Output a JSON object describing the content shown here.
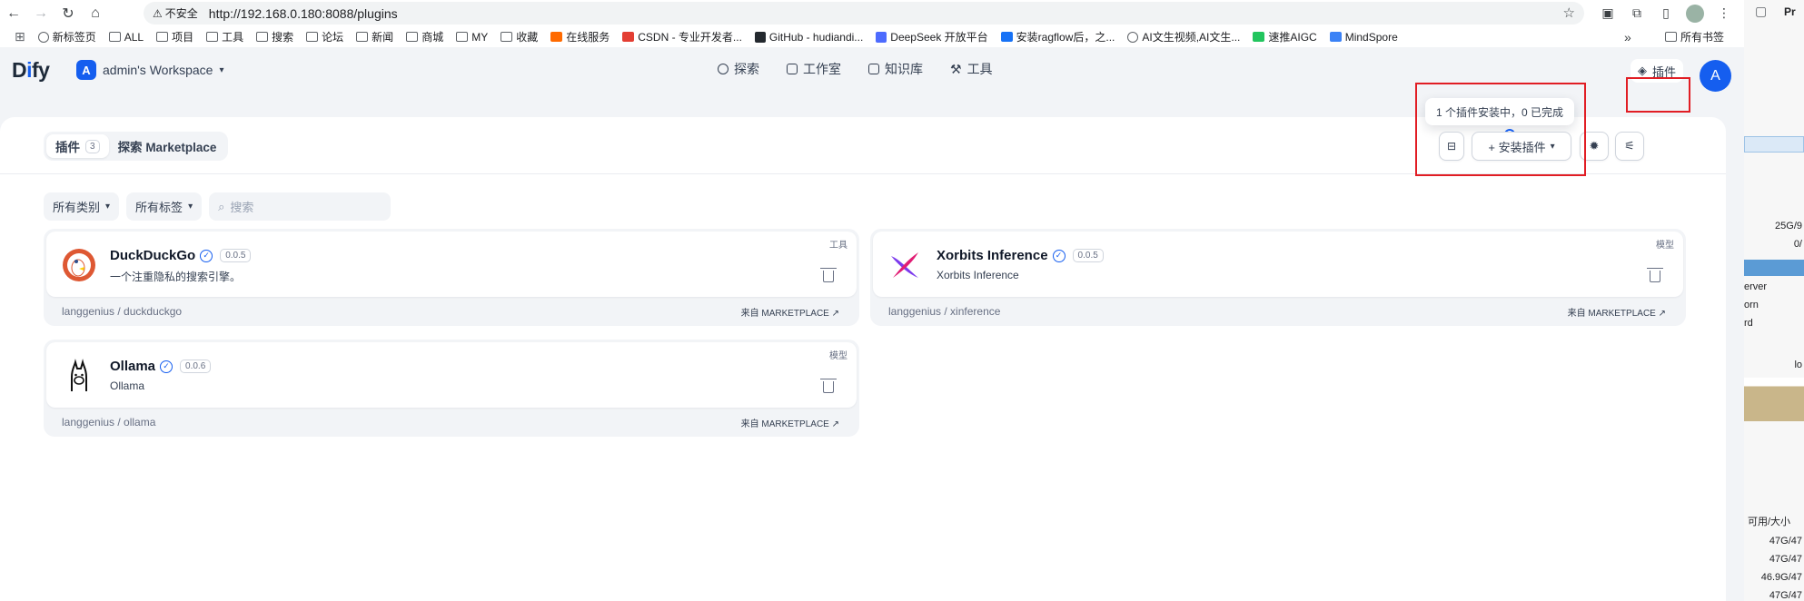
{
  "browser": {
    "url": "http://192.168.0.180:8088/plugins",
    "insecure_label": "不安全",
    "bookmarks": [
      {
        "label": "新标签页"
      },
      {
        "label": "ALL"
      },
      {
        "label": "项目"
      },
      {
        "label": "工具"
      },
      {
        "label": "搜索"
      },
      {
        "label": "论坛"
      },
      {
        "label": "新闻"
      },
      {
        "label": "商城"
      },
      {
        "label": "MY"
      },
      {
        "label": "收藏"
      },
      {
        "label": "在线服务"
      },
      {
        "label": "CSDN - 专业开发者..."
      },
      {
        "label": "GitHub - hudiandi..."
      },
      {
        "label": "DeepSeek 开放平台"
      },
      {
        "label": "安装ragflow后，之..."
      },
      {
        "label": "AI文生视频,AI文生..."
      },
      {
        "label": "速推AIGC"
      },
      {
        "label": "MindSpore"
      }
    ],
    "all_bookmarks": "所有书签",
    "more": "»"
  },
  "app": {
    "logo_pre": "D",
    "logo_accent": "i",
    "logo_post": "fy",
    "workspace_initial": "A",
    "workspace_name": "admin's Workspace",
    "nav": [
      {
        "label": "探索"
      },
      {
        "label": "工作室"
      },
      {
        "label": "知识库"
      },
      {
        "label": "工具"
      }
    ],
    "plugins_label": "插件",
    "user_initial": "A"
  },
  "plugins_page": {
    "tab_plugins": "插件",
    "tab_plugins_count": "3",
    "tab_marketplace": "探索 Marketplace",
    "install_label": "+ 安装插件",
    "tooltip": "1 个插件安装中，0 已完成",
    "filter_category": "所有类别",
    "filter_tags": "所有标签",
    "search_placeholder": "搜索",
    "plugins": [
      {
        "name": "DuckDuckGo",
        "version": "0.0.5",
        "desc": "一个注重隐私的搜索引擎。",
        "category": "工具",
        "org": "langgenius / duckduckgo",
        "source": "来自 MARKETPLACE ↗"
      },
      {
        "name": "Xorbits Inference",
        "version": "0.0.5",
        "desc": "Xorbits Inference",
        "category": "模型",
        "org": "langgenius / xinference",
        "source": "来自 MARKETPLACE ↗"
      },
      {
        "name": "Ollama",
        "version": "0.0.6",
        "desc": "Ollama",
        "category": "模型",
        "org": "langgenius / ollama",
        "source": "来自 MARKETPLACE ↗"
      }
    ]
  },
  "side_window": {
    "title": "Pr",
    "col_header": "可用/大小",
    "values": [
      "25G/9",
      "0/",
      "erver",
      "orn",
      "rd",
      "lo",
      "47G/47",
      "47G/47",
      "46.9G/47",
      "47G/47"
    ]
  }
}
